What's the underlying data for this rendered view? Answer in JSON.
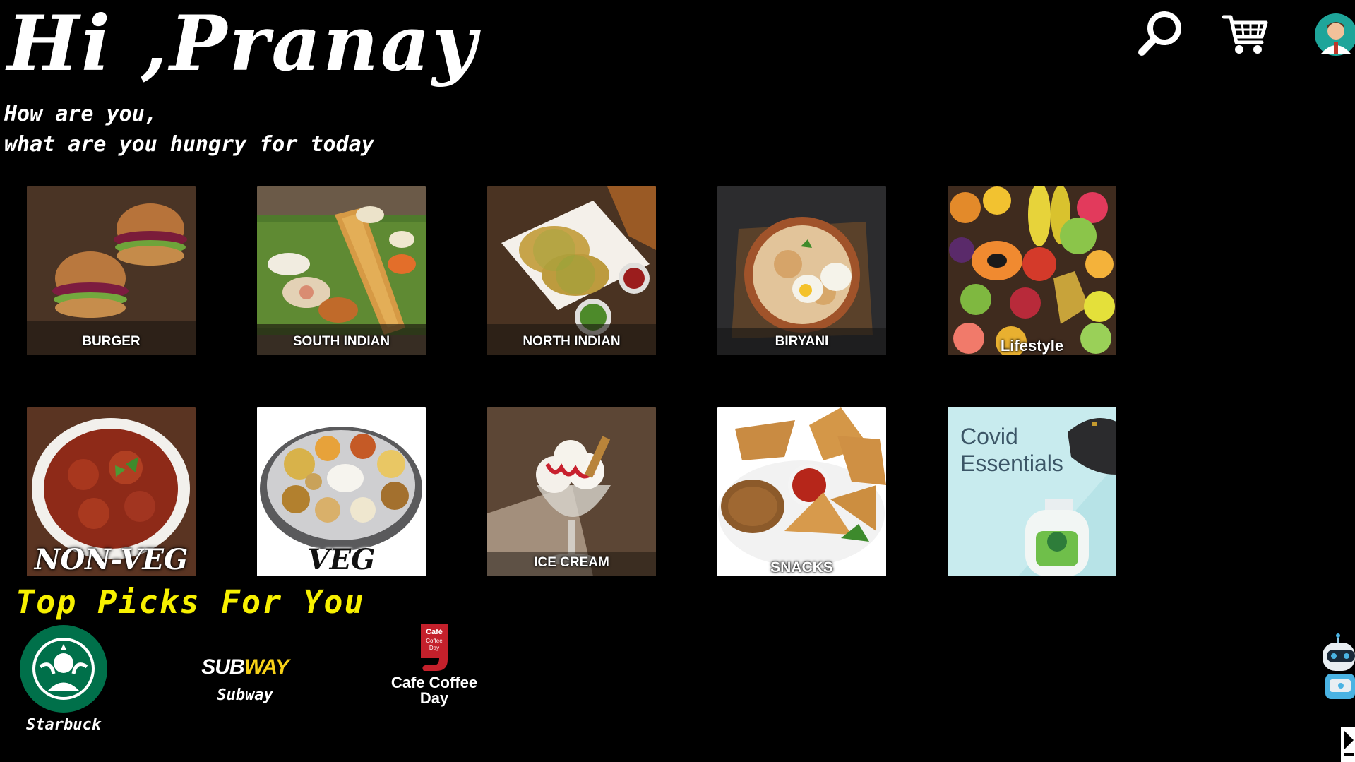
{
  "greeting": {
    "title": "Hi ,Pranay",
    "line1": "How are you,",
    "line2": "what are you hungry for today"
  },
  "header_icons": {
    "search": "search-icon",
    "cart": "cart-icon",
    "avatar": "user-avatar-icon"
  },
  "categories": [
    {
      "label": "BURGER",
      "style": "std"
    },
    {
      "label": "SOUTH INDIAN",
      "style": "std"
    },
    {
      "label": "NORTH INDIAN",
      "style": "std"
    },
    {
      "label": "BIRYANI",
      "style": "std"
    },
    {
      "label": "Lifestyle",
      "style": "std"
    },
    {
      "label": "NON-VEG",
      "style": "big"
    },
    {
      "label": "VEG",
      "style": "big-dark"
    },
    {
      "label": "ICE CREAM",
      "style": "std"
    },
    {
      "label": "SNACKS",
      "style": "std"
    },
    {
      "label": "",
      "style": "covid"
    }
  ],
  "covid": {
    "line1": "Covid",
    "line2": "Essentials"
  },
  "top_picks": {
    "title": "Top Picks For You",
    "items": [
      {
        "label": "Starbuck",
        "logo": "starbucks-logo"
      },
      {
        "label": "Subway",
        "logo": "subway-logo",
        "logo_text": "SUBWAY"
      },
      {
        "label": "Cafe Coffee Day",
        "logo": "ccd-logo",
        "logo_text": "Café Coffee Day"
      }
    ]
  },
  "colors": {
    "background": "#000000",
    "accent_yellow": "#f7f000",
    "text": "#ffffff"
  }
}
